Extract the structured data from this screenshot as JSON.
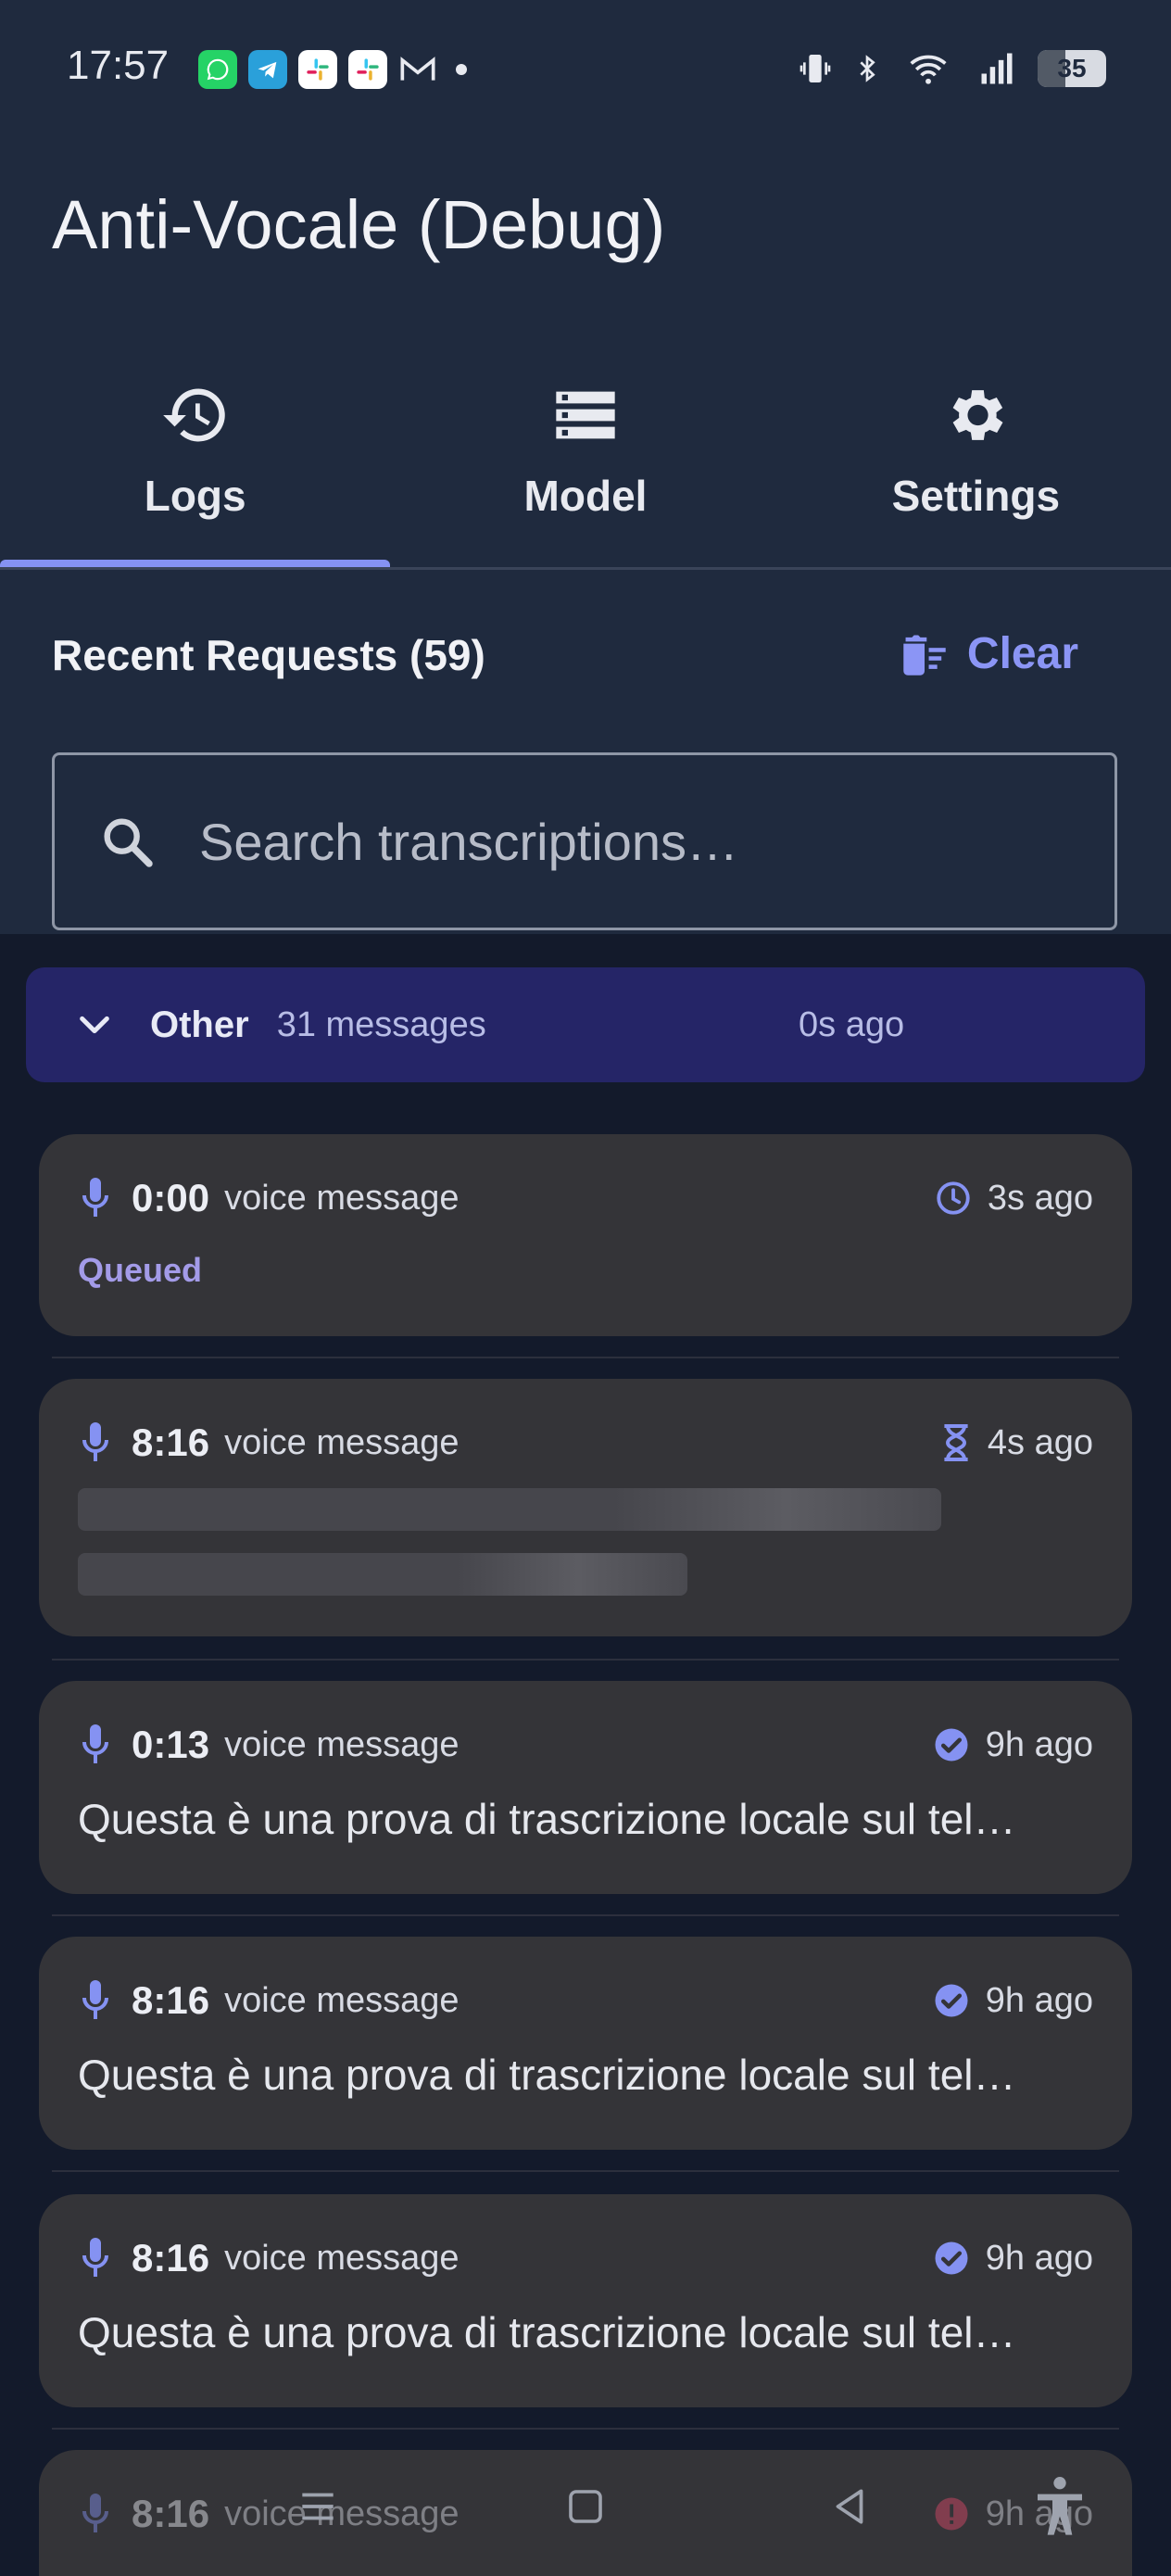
{
  "status_bar": {
    "time": "17:57",
    "notifications": [
      "whatsapp-icon",
      "telegram-icon",
      "slack-icon",
      "slack-icon",
      "gmail-icon"
    ],
    "battery": "35"
  },
  "app": {
    "title": "Anti-Vocale (Debug)"
  },
  "tabs": [
    {
      "label": "Logs",
      "icon": "history-icon",
      "selected": true
    },
    {
      "label": "Model",
      "icon": "storage-icon",
      "selected": false
    },
    {
      "label": "Settings",
      "icon": "gear-icon",
      "selected": false
    }
  ],
  "logs": {
    "header": "Recent Requests (59)",
    "clear_label": "Clear",
    "search_placeholder": "Search transcriptions…",
    "group": {
      "name": "Other",
      "count": "31 messages",
      "time": "0s ago"
    },
    "items": [
      {
        "duration": "0:00",
        "kind": "voice message",
        "status_icon": "clock-icon",
        "time": "3s ago",
        "status_text": "Queued",
        "text": ""
      },
      {
        "duration": "8:16",
        "kind": "voice message",
        "status_icon": "hourglass-icon",
        "time": "4s ago",
        "status_text": "",
        "text": ""
      },
      {
        "duration": "0:13",
        "kind": "voice message",
        "status_icon": "check-circle-icon",
        "time": "9h ago",
        "status_text": "",
        "text": "Questa è una prova di trascrizione locale sul tel…"
      },
      {
        "duration": "8:16",
        "kind": "voice message",
        "status_icon": "check-circle-icon",
        "time": "9h ago",
        "status_text": "",
        "text": "Questa è una prova di trascrizione locale sul tel…"
      },
      {
        "duration": "8:16",
        "kind": "voice message",
        "status_icon": "check-circle-icon",
        "time": "9h ago",
        "status_text": "",
        "text": "Questa è una prova di trascrizione locale sul tel…"
      },
      {
        "duration": "8:16",
        "kind": "voice message",
        "status_icon": "error-icon",
        "time": "9h ago",
        "status_text": "",
        "text": ""
      }
    ]
  },
  "colors": {
    "accent": "#8592f2",
    "group_bg": "#252567",
    "card_bg": "#343438",
    "header_bg": "#1f2a3e",
    "list_bg": "#131a2b"
  }
}
